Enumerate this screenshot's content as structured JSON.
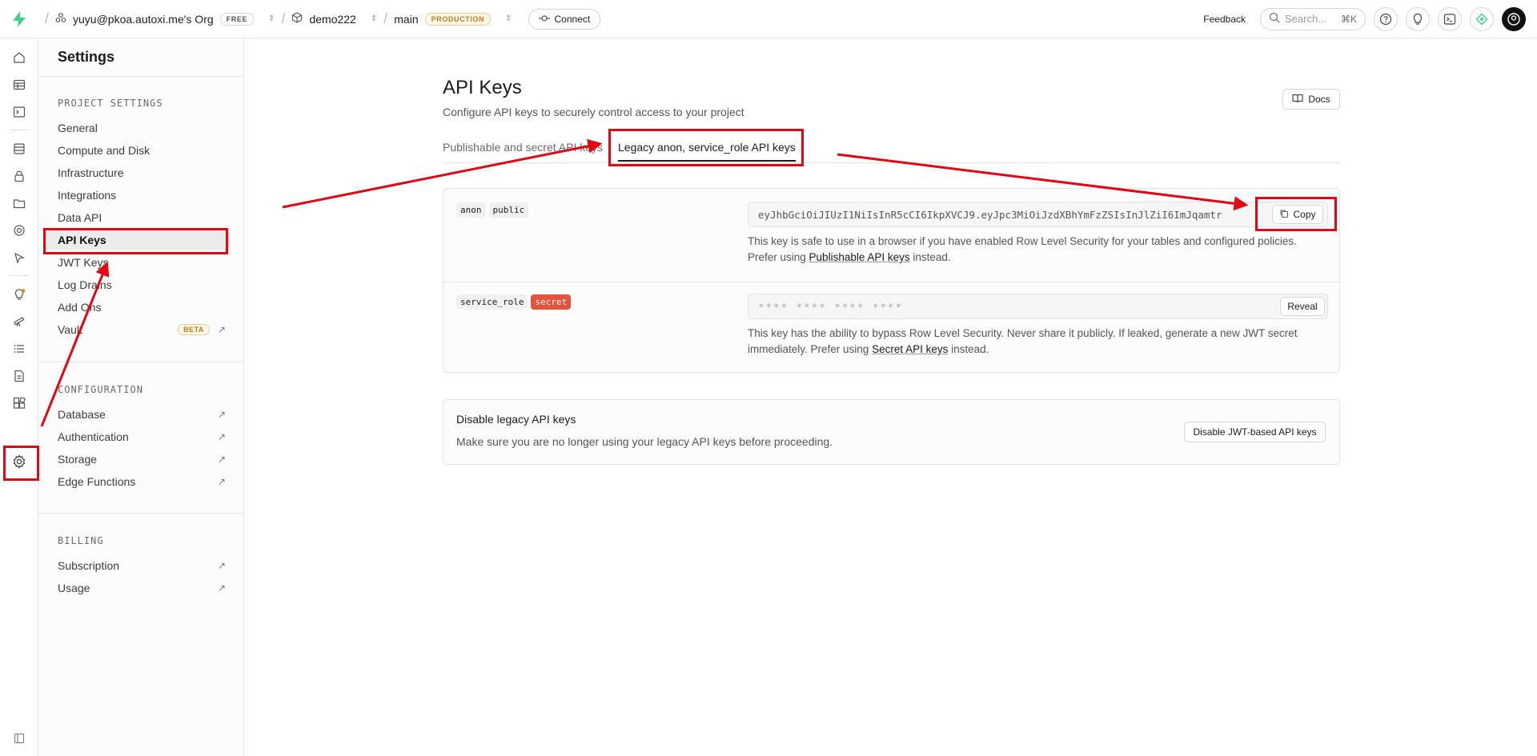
{
  "topbar": {
    "org_name": "yuyu@pkoa.autoxi.me's Org",
    "org_plan": "FREE",
    "project": "demo222",
    "branch": "main",
    "branch_badge": "PRODUCTION",
    "connect_label": "Connect",
    "feedback_label": "Feedback",
    "search_placeholder": "Search...",
    "search_shortcut": "⌘K"
  },
  "sidebar": {
    "title": "Settings",
    "project_settings_heading": "PROJECT SETTINGS",
    "project_items": [
      "General",
      "Compute and Disk",
      "Infrastructure",
      "Integrations",
      "Data API",
      "API Keys",
      "JWT Keys",
      "Log Drains",
      "Add Ons",
      "Vault"
    ],
    "vault_badge": "BETA",
    "configuration_heading": "CONFIGURATION",
    "configuration_items": [
      "Database",
      "Authentication",
      "Storage",
      "Edge Functions"
    ],
    "billing_heading": "BILLING",
    "billing_items": [
      "Subscription",
      "Usage"
    ]
  },
  "main": {
    "title": "API Keys",
    "subtitle": "Configure API keys to securely control access to your project",
    "docs_label": "Docs",
    "tabs": [
      "Publishable and secret API keys",
      "Legacy anon, service_role API keys"
    ],
    "anon": {
      "tag1": "anon",
      "tag2": "public",
      "key_value": "eyJhbGciOiJIUzI1NiIsInR5cCI6IkpXVCJ9.eyJpc3MiOiJzdXBhYmFzZSIsInJlZiI6ImJqamtr",
      "copy_label": "Copy",
      "help_text": "This key is safe to use in a browser if you have enabled Row Level Security for your tables and configured policies. Prefer using ",
      "help_link": "Publishable API keys",
      "help_suffix": " instead."
    },
    "service_role": {
      "tag1": "service_role",
      "tag2": "secret",
      "masked_value": "**** **** **** ****",
      "reveal_label": "Reveal",
      "help_text": "This key has the ability to bypass Row Level Security. Never share it publicly. If leaked, generate a new JWT secret immediately. Prefer using ",
      "help_link": "Secret API keys",
      "help_suffix": " instead."
    },
    "disable_card": {
      "title": "Disable legacy API keys",
      "subtitle": "Make sure you are no longer using your legacy API keys before proceeding.",
      "button_label": "Disable JWT-based API keys"
    }
  },
  "colors": {
    "brand_green": "#3ecf8e",
    "annotation_red": "#e30613",
    "secret_badge": "#e5533d",
    "production_badge": "#c77a12"
  }
}
